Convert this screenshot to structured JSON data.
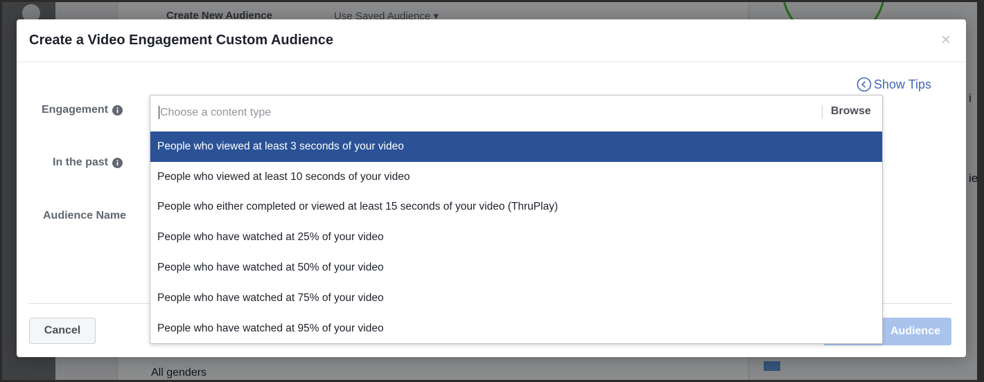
{
  "background": {
    "header_tab_1": "Create New Audience",
    "header_tab_2": "Use Saved Audience ▾",
    "bottom_text": "All genders",
    "side_glyph_1": "i",
    "side_glyph_2": "ie"
  },
  "dialog": {
    "title": "Create a Video Engagement Custom Audience",
    "show_tips_label": "Show Tips",
    "labels": {
      "engagement": "Engagement",
      "in_the_past": "In the past",
      "audience_name": "Audience Name"
    },
    "engagement_field": {
      "placeholder": "Choose a content type",
      "value": "",
      "browse_label": "Browse"
    },
    "options": [
      "People who viewed at least 3 seconds of your video",
      "People who viewed at least 10 seconds of your video",
      "People who either completed or viewed at least 15 seconds of your video (ThruPlay)",
      "People who have watched at 25% of your video",
      "People who have watched at 50% of your video",
      "People who have watched at 75% of your video",
      "People who have watched at 95% of your video"
    ],
    "selected_option_index": 0,
    "cancel_label": "Cancel",
    "create_label": "Audience"
  },
  "icons": {
    "close": "close-icon",
    "info": "info-icon",
    "show_tips": "chevron-left-circle-icon",
    "history": "clock-icon"
  },
  "colors": {
    "accent": "#4267b2",
    "selected_option": "#2b5297",
    "create_button_disabled": "#a9c3ec"
  }
}
